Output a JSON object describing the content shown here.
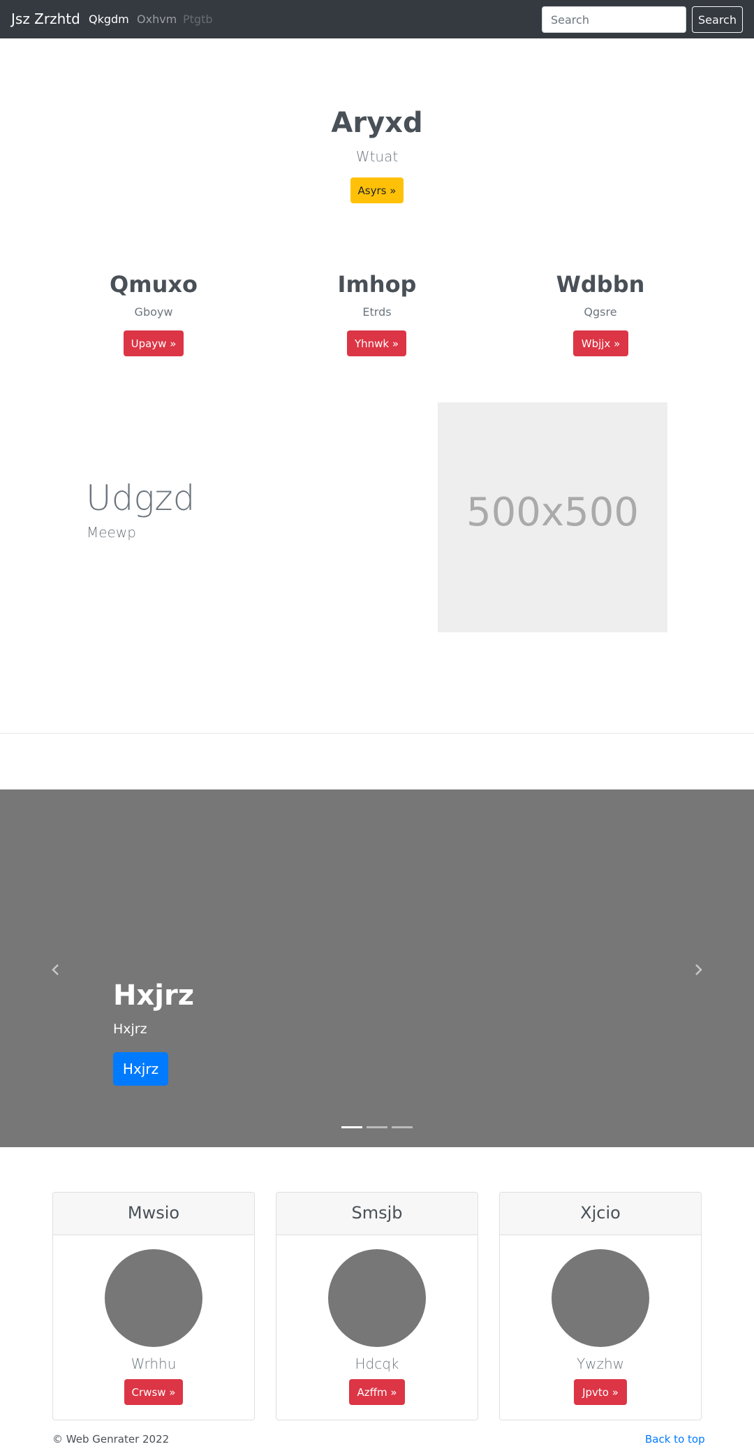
{
  "navbar": {
    "brand": "Jsz Zrzhtd",
    "links": [
      "Qkgdm",
      "Oxhvm",
      "Ptgtb"
    ],
    "search_placeholder": "Search",
    "search_button": "Search"
  },
  "hero": {
    "title": "Aryxd",
    "subtitle": "Wtuat",
    "button": "Asyrs »"
  },
  "features": [
    {
      "title": "Qmuxo",
      "subtitle": "Gboyw",
      "button": "Upayw »"
    },
    {
      "title": "Imhop",
      "subtitle": "Etrds",
      "button": "Yhnwk »"
    },
    {
      "title": "Wdbbn",
      "subtitle": "Qgsre",
      "button": "Wbjjx »"
    }
  ],
  "split": {
    "title": "Udgzd",
    "subtitle": "Meewp",
    "image_label": "500x500"
  },
  "carousel": {
    "title": "Hxjrz",
    "subtitle": "Hxjrz",
    "button": "Hxjrz",
    "slide_count": 3,
    "active_index": 0
  },
  "cards": [
    {
      "header": "Mwsio",
      "text": "Wrhhu",
      "button": "Crwsw »"
    },
    {
      "header": "Smsjb",
      "text": "Hdcqk",
      "button": "Azffm »"
    },
    {
      "header": "Xjcio",
      "text": "Ywzhw",
      "button": "Jpvto »"
    }
  ],
  "footer": {
    "copyright": "© Web Genrater 2022",
    "back_to_top": "Back to top"
  },
  "colors": {
    "navbar_bg": "#343a40",
    "warning": "#ffc107",
    "danger": "#dc3545",
    "primary": "#007bff",
    "carousel_bg": "#777777"
  }
}
